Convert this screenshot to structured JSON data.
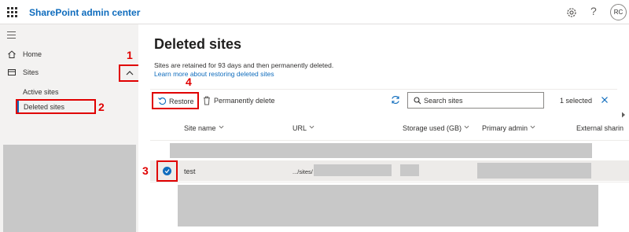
{
  "header": {
    "app_title": "SharePoint admin center",
    "avatar_initials": "RC",
    "icons": [
      "waffle-icon",
      "settings-icon",
      "help-icon"
    ]
  },
  "sidebar": {
    "items": [
      {
        "label": "Home",
        "icon": "home-icon"
      },
      {
        "label": "Sites",
        "icon": "sites-icon"
      }
    ],
    "sub_items": [
      {
        "label": "Active sites"
      },
      {
        "label": "Deleted sites",
        "selected": true
      }
    ]
  },
  "main": {
    "title": "Deleted sites",
    "info_text": "Sites are retained for 93 days and then permanently deleted.",
    "learn_link": "Learn more about restoring deleted sites",
    "commands": {
      "restore_label": "Restore",
      "delete_label": "Permanently delete",
      "search_placeholder": "Search sites",
      "selected_count": "1 selected"
    },
    "table": {
      "columns": [
        "Site name",
        "URL",
        "Storage used (GB)",
        "Primary admin",
        "External sharin"
      ],
      "rows": [
        {
          "site_name": "test",
          "url": ".../sites/",
          "selected": true
        }
      ]
    }
  },
  "annotations": {
    "step1": "1",
    "step2": "2",
    "step3": "3",
    "step4": "4"
  },
  "colors": {
    "accent": "#0f6cbd",
    "annotation": "#e00000",
    "redacted": "#c8c8c8"
  }
}
